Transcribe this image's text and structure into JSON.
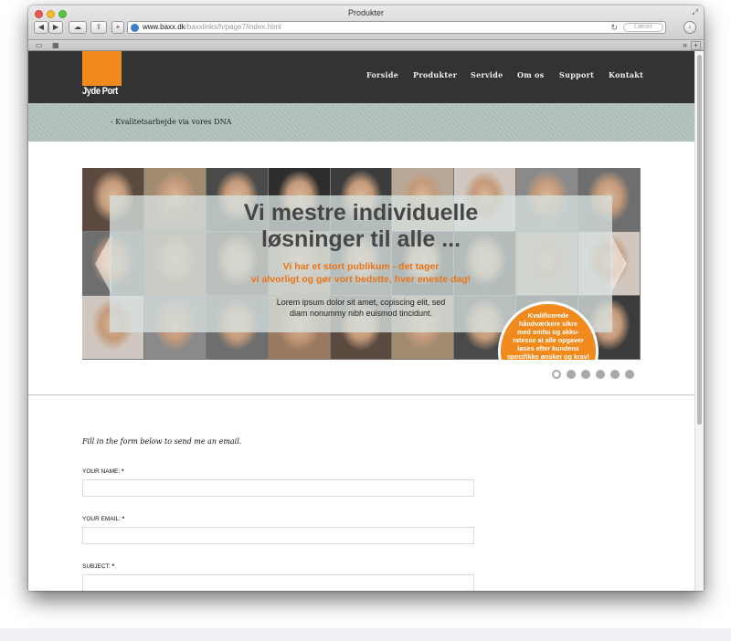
{
  "browser": {
    "window_title": "Produkter",
    "url_host": "www.baxx.dk",
    "url_path": "/baxxlinks/h/page7/index.html",
    "reader_label": "Læser",
    "tab_add_label": "+"
  },
  "site": {
    "logo_text": "Jyde Port",
    "nav": [
      "Forside",
      "Produkter",
      "Servide",
      "Om os",
      "Support",
      "Kontakt"
    ],
    "tagline": "- Kvalitetsarbejde via vores DNA"
  },
  "slider": {
    "heading_line1": "Vi mestre individuelle",
    "heading_line2": "løsninger til alle ...",
    "sub_line1": "Vi har et stort publikum - det tager",
    "sub_line2": "vi alvorligt og gør vort bedstte, hver eneste dag!",
    "lorem_line1": "Lorem ipsum dolor sit amet, copiscing elit, sed",
    "lorem_line2": "diam nonummy nibh euismod tincidunt.",
    "badge_lines": [
      "Kvalificerede",
      "håndværkere sikre",
      "med omhu og akku-",
      "ratesse at alle opgaver",
      "løses efter kundens",
      "specifikke ønsker og krav!"
    ],
    "dot_count": 6,
    "active_dot": 1
  },
  "form": {
    "intro": "Fill in the form below to send me an email.",
    "fields": [
      {
        "label": "YOUR NAME:",
        "required": "*",
        "value": ""
      },
      {
        "label": "YOUR EMAIL:",
        "required": "*",
        "value": ""
      },
      {
        "label": "SUBJECT:",
        "required": "*",
        "value": ""
      }
    ]
  },
  "colors": {
    "header_bg": "#333333",
    "accent_orange": "#f08a1c",
    "tagline_band": "#b5c4c1"
  }
}
